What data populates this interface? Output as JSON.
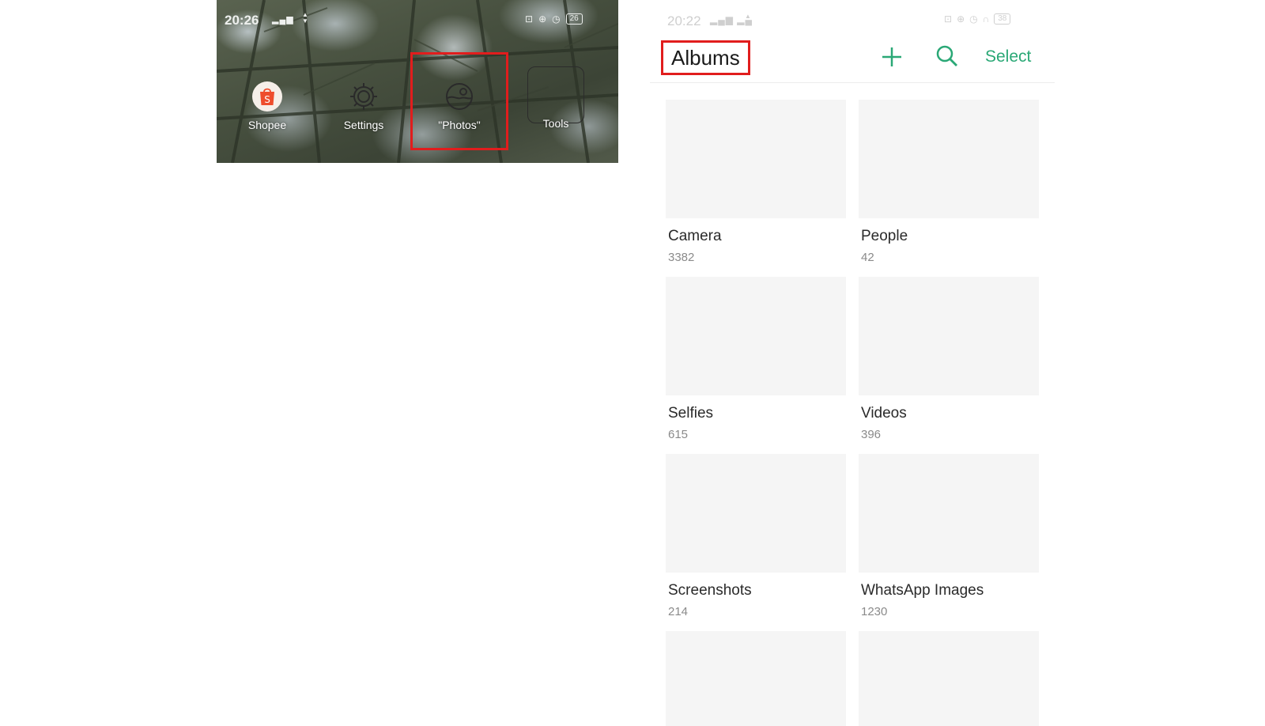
{
  "home_screen": {
    "status": {
      "time": "20:26",
      "battery": "26"
    },
    "apps": [
      {
        "label": "Shopee"
      },
      {
        "label": "Settings"
      },
      {
        "label": "\"Photos\""
      },
      {
        "label": "Tools"
      }
    ],
    "highlight_color": "#e11d1d"
  },
  "albums_screen": {
    "status": {
      "time": "20:22",
      "battery": "38"
    },
    "title": "Albums",
    "select_label": "Select",
    "accent_color": "#2aa876",
    "albums": [
      {
        "name": "Camera",
        "count": "3382"
      },
      {
        "name": "People",
        "count": "42"
      },
      {
        "name": "Selfies",
        "count": "615"
      },
      {
        "name": "Videos",
        "count": "396"
      },
      {
        "name": "Screenshots",
        "count": "214"
      },
      {
        "name": "WhatsApp Images",
        "count": "1230"
      },
      {
        "name": "",
        "count": ""
      },
      {
        "name": "",
        "count": ""
      }
    ]
  }
}
